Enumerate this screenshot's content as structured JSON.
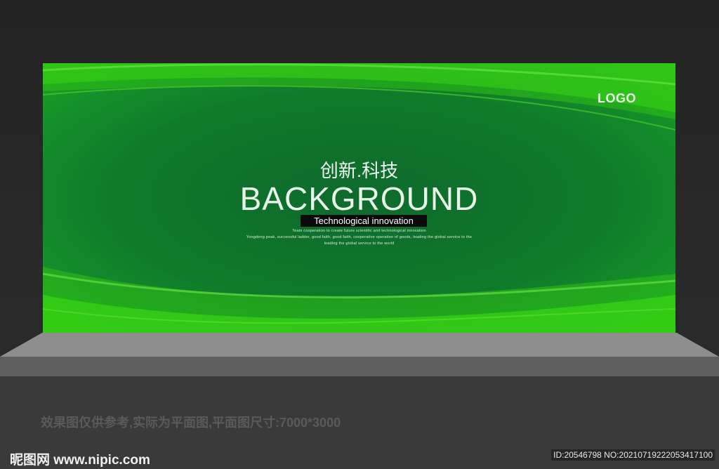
{
  "banner": {
    "logo": "LOGO",
    "cn_title": "创新.科技",
    "title": "BACKGROUND",
    "subtitle": "Technological innovation",
    "lines": [
      "Team cooperation to create future scientific and technological innovation",
      "Yongdeng peak, successful ladder, good faith, good faith, cooperative operation of goods, leading the global service to the",
      "leading the global service to the world"
    ]
  },
  "caption": "效果图仅供参考,实际为平面图,平面图尺寸:7000*3000",
  "watermark": {
    "site": "昵图网 www.nipic.com",
    "id": "ID:20546798 NO:20210719222053417100"
  }
}
